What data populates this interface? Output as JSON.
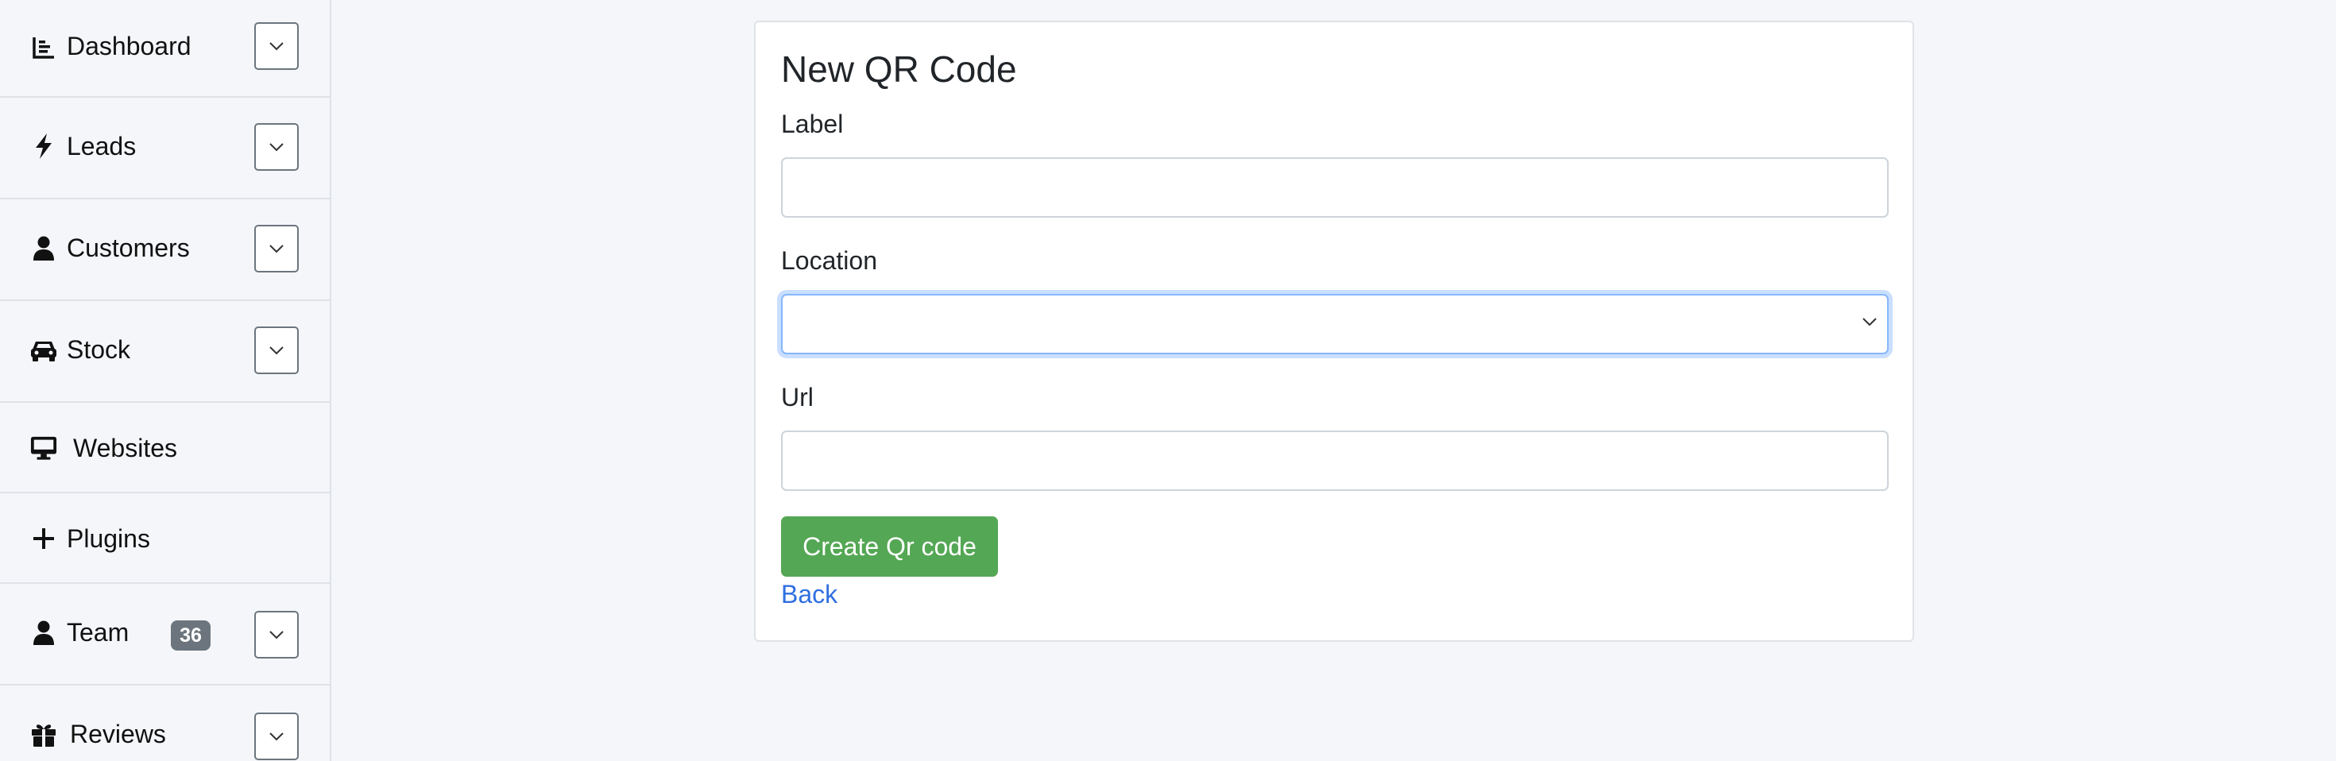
{
  "sidebar": {
    "items": [
      {
        "label": "Dashboard",
        "icon": "chart-icon"
      },
      {
        "label": "Leads",
        "icon": "bolt-icon"
      },
      {
        "label": "Customers",
        "icon": "user-icon"
      },
      {
        "label": "Stock",
        "icon": "car-icon"
      },
      {
        "label": "Websites",
        "icon": "monitor-icon"
      },
      {
        "label": "Plugins",
        "icon": "plus-icon"
      },
      {
        "label": "Team",
        "icon": "user-icon",
        "badge": "36"
      },
      {
        "label": "Reviews",
        "icon": "gift-icon"
      }
    ]
  },
  "form": {
    "title": "New QR Code",
    "label_field": {
      "label": "Label",
      "value": "",
      "placeholder": ""
    },
    "location_field": {
      "label": "Location",
      "value": ""
    },
    "url_field": {
      "label": "Url",
      "value": "",
      "placeholder": ""
    },
    "submit_label": "Create Qr code",
    "back_label": "Back"
  },
  "colors": {
    "background": "#f4f6fa",
    "submit_button": "#54a754",
    "link": "#2f6fe0",
    "badge": "#6c757d"
  }
}
